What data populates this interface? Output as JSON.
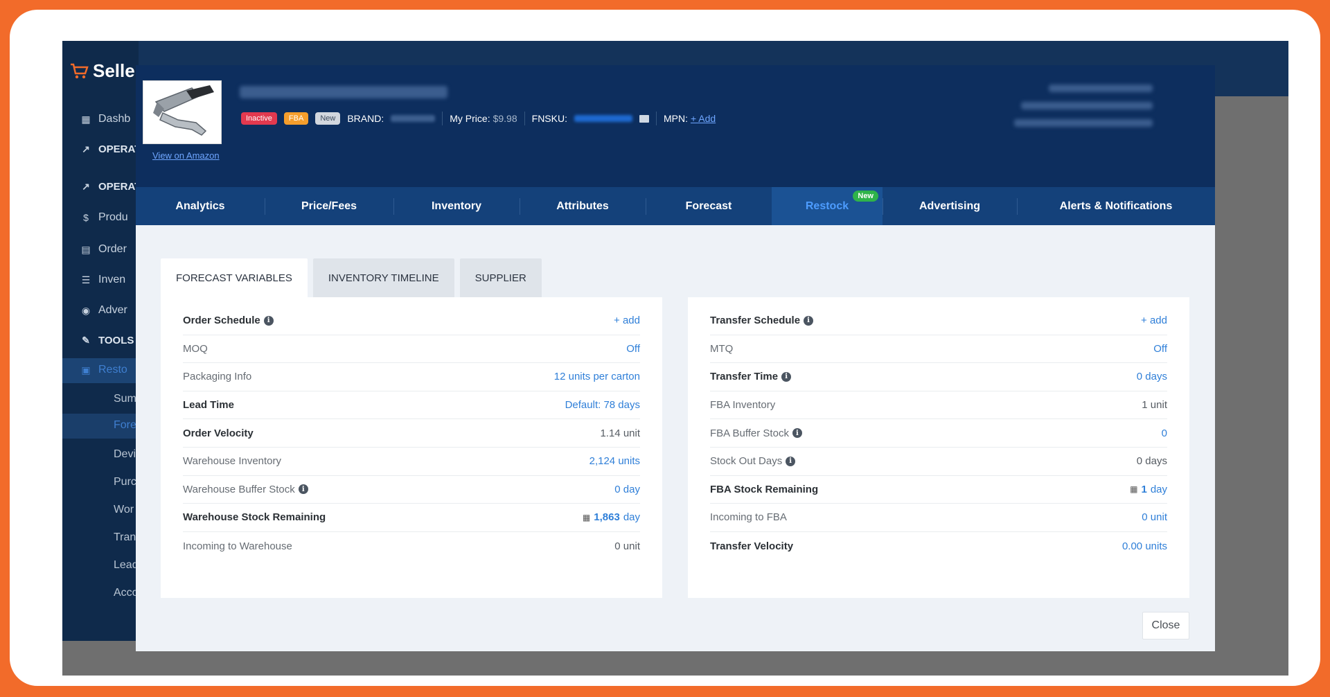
{
  "app": {
    "logo_text": "Seller",
    "sidebar": {
      "items": [
        {
          "icon": "grid-icon",
          "label": "Dashb"
        },
        {
          "icon": "chart-icon",
          "label": "OPERAT"
        },
        {
          "icon": "chart-icon",
          "label": "OPERAT"
        },
        {
          "icon": "dollar-icon",
          "label": "Produ"
        },
        {
          "icon": "list-icon",
          "label": "Order"
        },
        {
          "icon": "list-icon",
          "label": "Inven"
        },
        {
          "icon": "target-icon",
          "label": "Adver"
        },
        {
          "icon": "wrench-icon",
          "label": "TOOLS"
        },
        {
          "icon": "truck-icon",
          "label": "Resto"
        }
      ],
      "subitems": [
        "Sum",
        "Fore",
        "Devi",
        "Purc",
        "Wor",
        "Tran",
        "Lead",
        "Acco"
      ]
    }
  },
  "modal": {
    "header": {
      "view_link": "View on Amazon",
      "badges": {
        "inactive": "Inactive",
        "fba": "FBA",
        "new": "New"
      },
      "brand_label": "BRAND:",
      "my_price_label": "My Price:",
      "my_price_value": "$9.98",
      "fnsku_label": "FNSKU:",
      "mpn_label": "MPN:",
      "mpn_add": "+ Add"
    },
    "tabs": [
      {
        "label": "Analytics"
      },
      {
        "label": "Price/Fees"
      },
      {
        "label": "Inventory"
      },
      {
        "label": "Attributes"
      },
      {
        "label": "Forecast"
      },
      {
        "label": "Restock",
        "pill": "New",
        "active": true
      },
      {
        "label": "Advertising"
      },
      {
        "label": "Alerts & Notifications"
      }
    ],
    "subtabs": [
      "FORECAST VARIABLES",
      "INVENTORY TIMELINE",
      "SUPPLIER"
    ],
    "left_rows": [
      {
        "label": "Order Schedule",
        "value": "+ add"
      },
      {
        "label": "MOQ",
        "value": "Off"
      },
      {
        "label": "Packaging Info",
        "value": "12 units per carton"
      },
      {
        "label": "Lead Time",
        "value": "Default: 78 days"
      },
      {
        "label": "Order Velocity",
        "value": "1.14 unit"
      },
      {
        "label": "Warehouse Inventory",
        "value": "2,124 units"
      },
      {
        "label": "Warehouse Buffer Stock",
        "value": "0 day"
      },
      {
        "label": "Warehouse Stock Remaining",
        "value_num": "1,863",
        "value_unit": "day"
      },
      {
        "label": "Incoming to Warehouse",
        "value": "0 unit"
      }
    ],
    "right_rows": [
      {
        "label": "Transfer Schedule",
        "value": "+ add"
      },
      {
        "label": "MTQ",
        "value": "Off"
      },
      {
        "label": "Transfer Time",
        "value": "0 days"
      },
      {
        "label": "FBA Inventory",
        "value": "1 unit"
      },
      {
        "label": "FBA Buffer Stock",
        "value": "0"
      },
      {
        "label": "Stock Out Days",
        "value": "0 days"
      },
      {
        "label": "FBA Stock Remaining",
        "value_num": "1",
        "value_unit": "day"
      },
      {
        "label": "Incoming to FBA",
        "value": "0 unit"
      },
      {
        "label": "Transfer Velocity",
        "value": "0.00 units"
      }
    ],
    "close_label": "Close"
  }
}
